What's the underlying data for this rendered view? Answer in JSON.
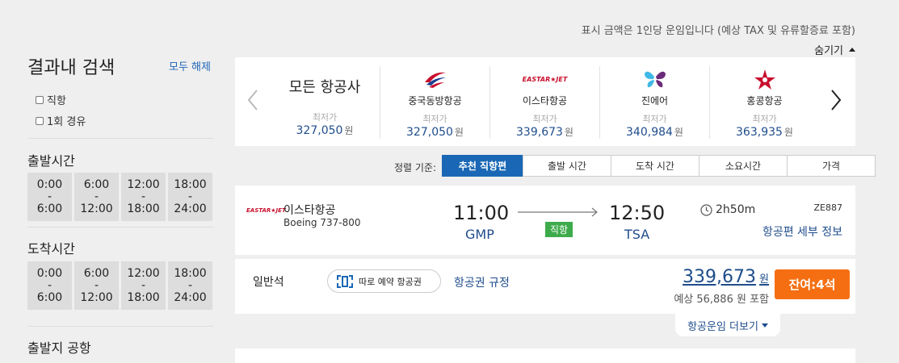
{
  "notice": "표시 금액은 1인당 운임입니다 (예상 TAX 및 유류할증료 포함)",
  "hide_label": "숨기기",
  "sidebar": {
    "title": "결과내 검색",
    "clear_all": "모두 해제",
    "filters": {
      "direct": "직항",
      "one_stop": "1회 경유"
    },
    "departure_title": "출발시간",
    "arrival_title": "도착시간",
    "departure_airport_title": "출발지 공항",
    "time_ranges": [
      {
        "from": "0:00",
        "dash": "-",
        "to": "6:00"
      },
      {
        "from": "6:00",
        "dash": "-",
        "to": "12:00"
      },
      {
        "from": "12:00",
        "dash": "-",
        "to": "18:00"
      },
      {
        "from": "18:00",
        "dash": "-",
        "to": "24:00"
      }
    ]
  },
  "airlines": {
    "all": {
      "name": "모든 항공사",
      "min_label": "최저가",
      "price": "327,050",
      "won": "원"
    },
    "items": [
      {
        "name": "중국동방항공",
        "min_label": "최저가",
        "price": "327,050",
        "won": "원",
        "icon": "china-eastern-logo"
      },
      {
        "name": "이스타항공",
        "min_label": "최저가",
        "price": "339,673",
        "won": "원",
        "icon": "eastar-jet-logo",
        "logo_text": "EASTAR★JET"
      },
      {
        "name": "진에어",
        "min_label": "최저가",
        "price": "340,984",
        "won": "원",
        "icon": "jin-air-logo"
      },
      {
        "name": "홍콩항공",
        "min_label": "최저가",
        "price": "363,935",
        "won": "원",
        "icon": "hong-kong-airlines-logo"
      }
    ]
  },
  "sort": {
    "label": "정렬 기준:",
    "options": [
      "추천 직항편",
      "출발 시간",
      "도착 시간",
      "소요시간",
      "가격"
    ],
    "active": 0
  },
  "flight": {
    "airline": "이스타항공",
    "logo_text": "EASTAR★JET",
    "aircraft": "Boeing 737-800",
    "dep_time": "11:00",
    "dep_airport": "GMP",
    "arr_time": "12:50",
    "arr_airport": "TSA",
    "direct_label": "직항",
    "duration": "2h50m",
    "code": "ZE887",
    "detail_link": "항공편 세부 정보"
  },
  "fare": {
    "class": "일반석",
    "separate_ticket": "따로 예약 항공권",
    "rule_link": "항공권 규정",
    "price": "339,673",
    "won": "원",
    "estimate": "예상 56,886 원 포함",
    "seats_button": "잔여:4석"
  },
  "more_fares": "항공운임 더보기",
  "colors": {
    "accent": "#1a68b5",
    "price": "#1f4d8c",
    "seats": "#f56f12",
    "direct": "#3dab4b"
  }
}
